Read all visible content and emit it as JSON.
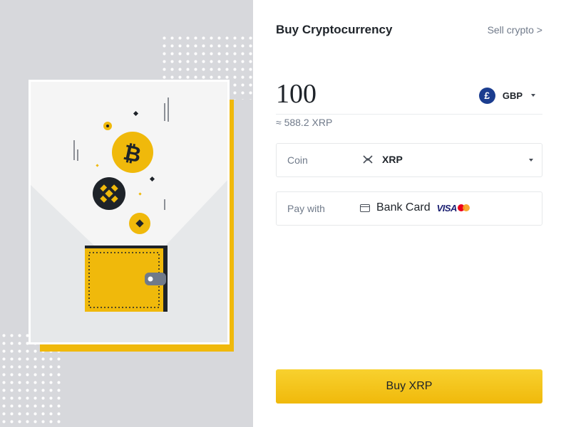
{
  "header": {
    "title": "Buy Cryptocurrency",
    "sell_link": "Sell crypto >"
  },
  "amount": {
    "value": "100",
    "currency_symbol": "£",
    "currency_code": "GBP",
    "approx_text": "≈ 588.2 XRP"
  },
  "coin_field": {
    "label": "Coin",
    "value": "XRP"
  },
  "pay_field": {
    "label": "Pay with",
    "method": "Bank Card",
    "visa_text": "VISA"
  },
  "buy_button": {
    "label": "Buy XRP"
  },
  "colors": {
    "brand_yellow": "#f0b90b",
    "gbp_blue": "#1b3d8f",
    "panel_gray": "#d7d8dc"
  },
  "icons": [
    "bitcoin-icon",
    "bnb-icon",
    "xrp-icon",
    "gbp-icon",
    "bank-card-icon",
    "visa-logo",
    "mastercard-logo",
    "wallet-icon"
  ]
}
